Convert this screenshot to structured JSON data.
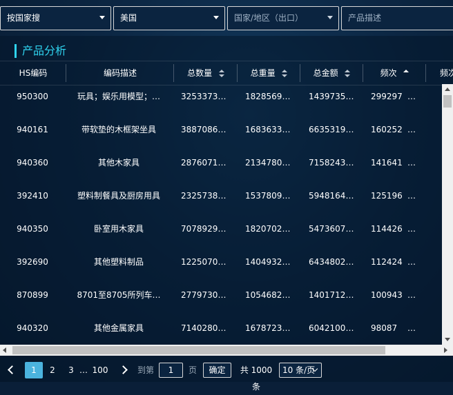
{
  "filters": {
    "search_mode": "按国家搜",
    "country": "美国",
    "region_placeholder": "国家/地区（出口）",
    "product_placeholder": "产品描述"
  },
  "panel": {
    "title": "产品分析"
  },
  "table": {
    "columns": [
      "HS编码",
      "编码描述",
      "总数量",
      "总重量",
      "总金额",
      "频次",
      "频次"
    ],
    "rows": [
      {
        "hs": "950300",
        "desc": "玩具；娱乐用模型；…",
        "qty": "3253373…",
        "weight": "1828569…",
        "amount": "1439735…",
        "freq": "299297",
        "more": "…"
      },
      {
        "hs": "940161",
        "desc": "带软垫的木框架坐具",
        "qty": "3887086…",
        "weight": "1683633…",
        "amount": "6635319…",
        "freq": "160252",
        "more": "…"
      },
      {
        "hs": "940360",
        "desc": "其他木家具",
        "qty": "2876071…",
        "weight": "2134780…",
        "amount": "7158243…",
        "freq": "141641",
        "more": "…"
      },
      {
        "hs": "392410",
        "desc": "塑料制餐具及厨房用具",
        "qty": "2325738…",
        "weight": "1537809…",
        "amount": "5948164…",
        "freq": "125196",
        "more": "…"
      },
      {
        "hs": "940350",
        "desc": "卧室用木家具",
        "qty": "7078929…",
        "weight": "1820702…",
        "amount": "5473607…",
        "freq": "114426",
        "more": "…"
      },
      {
        "hs": "392690",
        "desc": "其他塑料制品",
        "qty": "1225070…",
        "weight": "1404932…",
        "amount": "6434802…",
        "freq": "112424",
        "more": "…"
      },
      {
        "hs": "870899",
        "desc": "8701至8705所列车…",
        "qty": "2779730…",
        "weight": "1054682…",
        "amount": "1401712…",
        "freq": "100943",
        "more": "…"
      },
      {
        "hs": "940320",
        "desc": "其他金属家具",
        "qty": "7140280…",
        "weight": "1678723…",
        "amount": "6042100…",
        "freq": "98087",
        "more": "…"
      }
    ]
  },
  "pagination": {
    "pages": [
      "1",
      "2",
      "3",
      "…",
      "100"
    ],
    "goto_label": "到第",
    "goto_value": "1",
    "page_unit": "页",
    "confirm_label": "确定",
    "total_text": "共 1000 条",
    "page_size": "10 条/页"
  },
  "colors": {
    "accent": "#2fd4f0",
    "active_page": "#4bb3de",
    "background": "#0a1f38"
  }
}
